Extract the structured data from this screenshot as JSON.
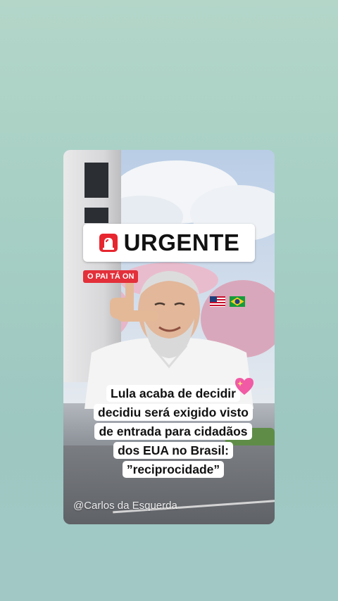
{
  "post": {
    "badge_text": "URGENTE",
    "channel_tag": "O PAI TÁ ON",
    "headline_lines": [
      "Lula acaba de decidir",
      "decidiu será exigido visto",
      "de entrada para cidadãos",
      "dos EUA no Brasil:",
      "”reciprocidade”"
    ],
    "watermark": "@Carlos da Esquerda",
    "icons": [
      "siren-icon",
      "us-flag-icon",
      "brazil-flag-icon",
      "sparkling-heart-icon"
    ]
  },
  "colors": {
    "background": "#a7cfc4",
    "tag_red": "#e3303a",
    "badge_bg": "#ffffff"
  }
}
